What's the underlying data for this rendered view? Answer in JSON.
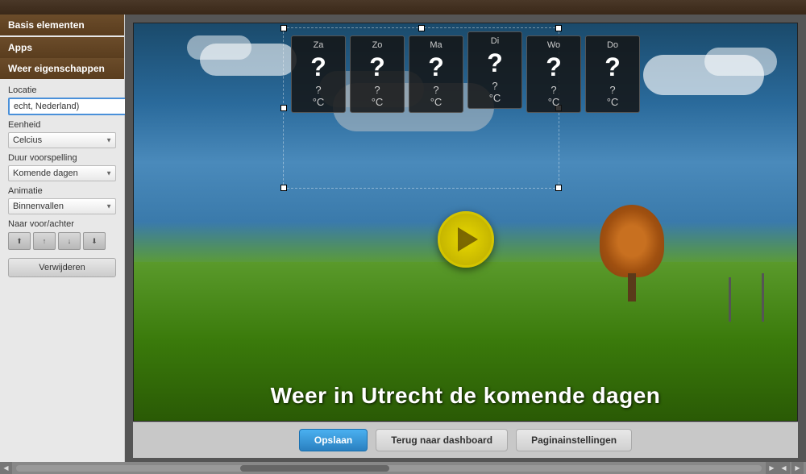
{
  "topbar": {},
  "sidebar": {
    "basis_elementen_label": "Basis elementen",
    "apps_label": "Apps",
    "weer_eigenschappen_label": "Weer eigenschappen",
    "locatie_label": "Locatie",
    "locatie_value": "echt, Nederland)",
    "eenheid_label": "Eenheid",
    "eenheid_value": "Celcius",
    "duur_label": "Duur voorspelling",
    "duur_value": "Komende dagen",
    "animatie_label": "Animatie",
    "animatie_value": "Binnenvallen",
    "naar_label": "Naar voor/achter",
    "verwijderen_label": "Verwijderen",
    "layer_icons": [
      "▲▼",
      "▲",
      "▼",
      "▲▼"
    ]
  },
  "canvas": {
    "days": [
      "Za",
      "Zo",
      "Ma",
      "Di",
      "Wo",
      "Do"
    ],
    "question_mark": "?",
    "temp": "?°C",
    "weather_text": "Weer in Utrecht de komende dagen"
  },
  "toolbar": {
    "opslaan_label": "Opslaan",
    "terug_label": "Terug naar dashboard",
    "pagina_label": "Paginainstellingen"
  }
}
